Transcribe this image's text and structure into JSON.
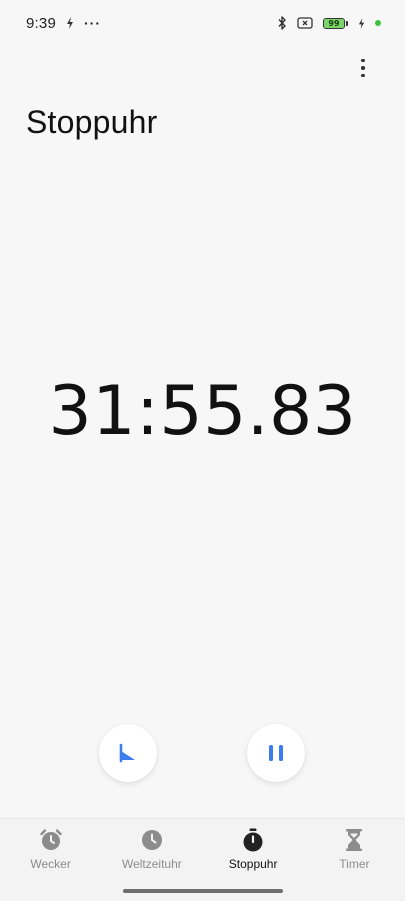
{
  "status_bar": {
    "time": "9:39",
    "battery_level": "99",
    "battery_fraction": 0.99,
    "more_indicator": "···",
    "charging_dot_color": "#3fc33f"
  },
  "header": {
    "title": "Stoppuhr",
    "menu_icon": "more-vert-icon"
  },
  "stopwatch": {
    "elapsed": "31:55.83"
  },
  "controls": {
    "lap_icon": "flag-icon",
    "pause_icon": "pause-icon",
    "accent_color": "#3b7ded"
  },
  "bottom_nav": {
    "items": [
      {
        "label": "Wecker",
        "icon": "alarm-clock-icon",
        "active": false
      },
      {
        "label": "Weltzeituhr",
        "icon": "clock-icon",
        "active": false
      },
      {
        "label": "Stoppuhr",
        "icon": "stopwatch-icon",
        "active": true
      },
      {
        "label": "Timer",
        "icon": "hourglass-icon",
        "active": false
      }
    ]
  }
}
